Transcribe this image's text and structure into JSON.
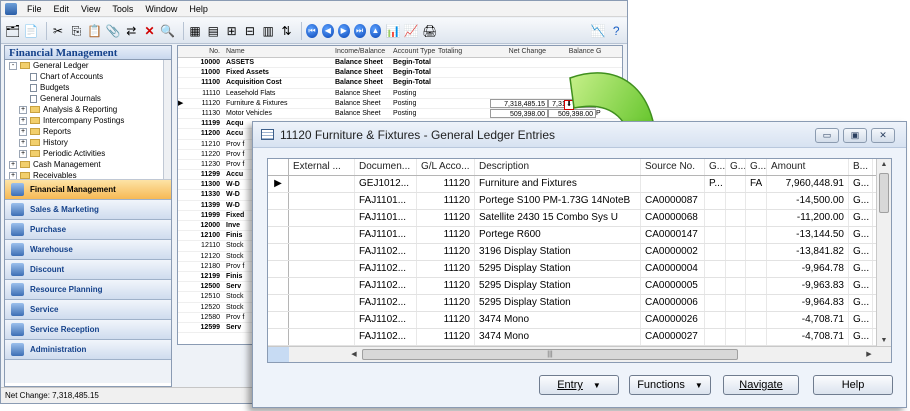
{
  "menubar": {
    "items": [
      "File",
      "Edit",
      "View",
      "Tools",
      "Window",
      "Help"
    ]
  },
  "navigation": {
    "title": "Financial Management",
    "tree": [
      {
        "label": "General Ledger",
        "level": 0,
        "type": "folder",
        "expander": "-"
      },
      {
        "label": "Chart of Accounts",
        "level": 1,
        "type": "doc"
      },
      {
        "label": "Budgets",
        "level": 1,
        "type": "doc"
      },
      {
        "label": "General Journals",
        "level": 1,
        "type": "doc"
      },
      {
        "label": "Analysis & Reporting",
        "level": 1,
        "type": "folder",
        "expander": "+"
      },
      {
        "label": "Intercompany Postings",
        "level": 1,
        "type": "folder",
        "expander": "+"
      },
      {
        "label": "Reports",
        "level": 1,
        "type": "folder",
        "expander": "+"
      },
      {
        "label": "History",
        "level": 1,
        "type": "folder",
        "expander": "+"
      },
      {
        "label": "Periodic Activities",
        "level": 1,
        "type": "folder",
        "expander": "+"
      },
      {
        "label": "Cash Management",
        "level": 0,
        "type": "folder",
        "expander": "+"
      },
      {
        "label": "Receivables",
        "level": 0,
        "type": "folder",
        "expander": "+"
      }
    ],
    "menu_buttons": [
      {
        "label": "Financial Management",
        "active": true
      },
      {
        "label": "Sales & Marketing",
        "active": false
      },
      {
        "label": "Purchase",
        "active": false
      },
      {
        "label": "Warehouse",
        "active": false
      },
      {
        "label": "Discount",
        "active": false
      },
      {
        "label": "Resource Planning",
        "active": false
      },
      {
        "label": "Service",
        "active": false
      },
      {
        "label": "Service Reception",
        "active": false
      },
      {
        "label": "Administration",
        "active": false
      }
    ]
  },
  "status_bar": {
    "text": "Net Change: 7,318,485.15"
  },
  "chart_of_accounts": {
    "columns": [
      "No.",
      "Name",
      "Income/Balance",
      "Account Type",
      "Totaling",
      "Net Change",
      "Balance",
      "G"
    ],
    "rows": [
      {
        "no": "10000",
        "name": "ASSETS",
        "ib": "Balance Sheet",
        "type": "Begin-Total",
        "nc": "",
        "bal": "",
        "g": "",
        "bold": true
      },
      {
        "no": "11000",
        "name": "Fixed Assets",
        "ib": "Balance Sheet",
        "type": "Begin-Total",
        "nc": "",
        "bal": "",
        "g": "",
        "bold": true
      },
      {
        "no": "11100",
        "name": "Acquisition Cost",
        "ib": "Balance Sheet",
        "type": "Begin-Total",
        "nc": "",
        "bal": "",
        "g": "",
        "bold": true
      },
      {
        "no": "11110",
        "name": "Leasehold Flats",
        "ib": "Balance Sheet",
        "type": "Posting",
        "nc": "",
        "bal": "",
        "g": "",
        "bold": false
      },
      {
        "no": "11120",
        "name": "Furniture & Fixtures",
        "ib": "Balance Sheet",
        "type": "Posting",
        "nc": "7,318,485.15",
        "bal": "7,318,485.15",
        "g": "P",
        "bold": false,
        "selected": true
      },
      {
        "no": "11130",
        "name": "Motor Vehicles",
        "ib": "Balance Sheet",
        "type": "Posting",
        "nc": "509,398.00",
        "bal": "509,398.00",
        "g": "P",
        "bold": false
      },
      {
        "no": "11199",
        "name": "Acqu",
        "bold": true
      },
      {
        "no": "11200",
        "name": "Accu",
        "bold": true
      },
      {
        "no": "11210",
        "name": "Prov f",
        "bold": false
      },
      {
        "no": "11220",
        "name": "Prov f",
        "bold": false
      },
      {
        "no": "11230",
        "name": "Prov f",
        "bold": false
      },
      {
        "no": "11299",
        "name": "Accu",
        "bold": true
      },
      {
        "no": "11300",
        "name": "W-D",
        "bold": true
      },
      {
        "no": "11330",
        "name": "W-D",
        "bold": true
      },
      {
        "no": "11399",
        "name": "W-D",
        "bold": true
      },
      {
        "no": "11999",
        "name": "Fixed",
        "bold": true
      },
      {
        "no": "12000",
        "name": "Inve",
        "bold": true
      },
      {
        "no": "12100",
        "name": "Finis",
        "bold": true
      },
      {
        "no": "12110",
        "name": "Stock",
        "bold": false
      },
      {
        "no": "12120",
        "name": "Stock",
        "bold": false
      },
      {
        "no": "12180",
        "name": "Prov f",
        "bold": false
      },
      {
        "no": "12199",
        "name": "Finis",
        "bold": true
      },
      {
        "no": "12500",
        "name": "Serv",
        "bold": true
      },
      {
        "no": "12510",
        "name": "Stock",
        "bold": false
      },
      {
        "no": "12520",
        "name": "Stock",
        "bold": false
      },
      {
        "no": "12580",
        "name": "Prov f",
        "bold": false
      },
      {
        "no": "12599",
        "name": "Serv",
        "bold": true
      }
    ]
  },
  "entries_window": {
    "title": "11120 Furniture & Fixtures - General Ledger Entries",
    "columns": [
      "External ...",
      "Documen...",
      "G/L Acco...",
      "Description",
      "Source No.",
      "G...",
      "G...",
      "G...",
      "Amount",
      "B..."
    ],
    "rows": [
      {
        "ext": "",
        "doc": "GEJ1012...",
        "gl": "11120",
        "desc": "Furniture and Fixtures",
        "src": "",
        "g1": "P...",
        "g2": "",
        "g3": "FA",
        "amount": "7,960,448.91",
        "b": "G...",
        "current": true
      },
      {
        "ext": "",
        "doc": "FAJ1101...",
        "gl": "11120",
        "desc": "Portege S100 PM-1.73G 14NoteB",
        "src": "CA0000087",
        "g1": "",
        "g2": "",
        "g3": "",
        "amount": "-14,500.00",
        "b": "G..."
      },
      {
        "ext": "",
        "doc": "FAJ1101...",
        "gl": "11120",
        "desc": "Satellite 2430 15 Combo Sys U",
        "src": "CA0000068",
        "g1": "",
        "g2": "",
        "g3": "",
        "amount": "-11,200.00",
        "b": "G..."
      },
      {
        "ext": "",
        "doc": "FAJ1101...",
        "gl": "11120",
        "desc": "Portege R600",
        "src": "CA0000147",
        "g1": "",
        "g2": "",
        "g3": "",
        "amount": "-13,144.50",
        "b": "G..."
      },
      {
        "ext": "",
        "doc": "FAJ1102...",
        "gl": "11120",
        "desc": "3196 Display Station",
        "src": "CA0000002",
        "g1": "",
        "g2": "",
        "g3": "",
        "amount": "-13,841.82",
        "b": "G..."
      },
      {
        "ext": "",
        "doc": "FAJ1102...",
        "gl": "11120",
        "desc": "5295 Display Station",
        "src": "CA0000004",
        "g1": "",
        "g2": "",
        "g3": "",
        "amount": "-9,964.78",
        "b": "G..."
      },
      {
        "ext": "",
        "doc": "FAJ1102...",
        "gl": "11120",
        "desc": "5295 Display Station",
        "src": "CA0000005",
        "g1": "",
        "g2": "",
        "g3": "",
        "amount": "-9,963.83",
        "b": "G..."
      },
      {
        "ext": "",
        "doc": "FAJ1102...",
        "gl": "11120",
        "desc": "5295 Display Station",
        "src": "CA0000006",
        "g1": "",
        "g2": "",
        "g3": "",
        "amount": "-9,964.83",
        "b": "G..."
      },
      {
        "ext": "",
        "doc": "FAJ1102...",
        "gl": "11120",
        "desc": "3474 Mono",
        "src": "CA0000026",
        "g1": "",
        "g2": "",
        "g3": "",
        "amount": "-4,708.71",
        "b": "G..."
      },
      {
        "ext": "",
        "doc": "FAJ1102...",
        "gl": "11120",
        "desc": "3474 Mono",
        "src": "CA0000027",
        "g1": "",
        "g2": "",
        "g3": "",
        "amount": "-4,708.71",
        "b": "G..."
      }
    ],
    "buttons": {
      "entry": "Entry",
      "functions": "Functions",
      "navigate": "Navigate",
      "help": "Help"
    }
  },
  "colors": {
    "nav_title": "#15428b",
    "active_menu": "#f6b955",
    "arrow_green": "#4caf26",
    "drill_border": "#d00000"
  }
}
